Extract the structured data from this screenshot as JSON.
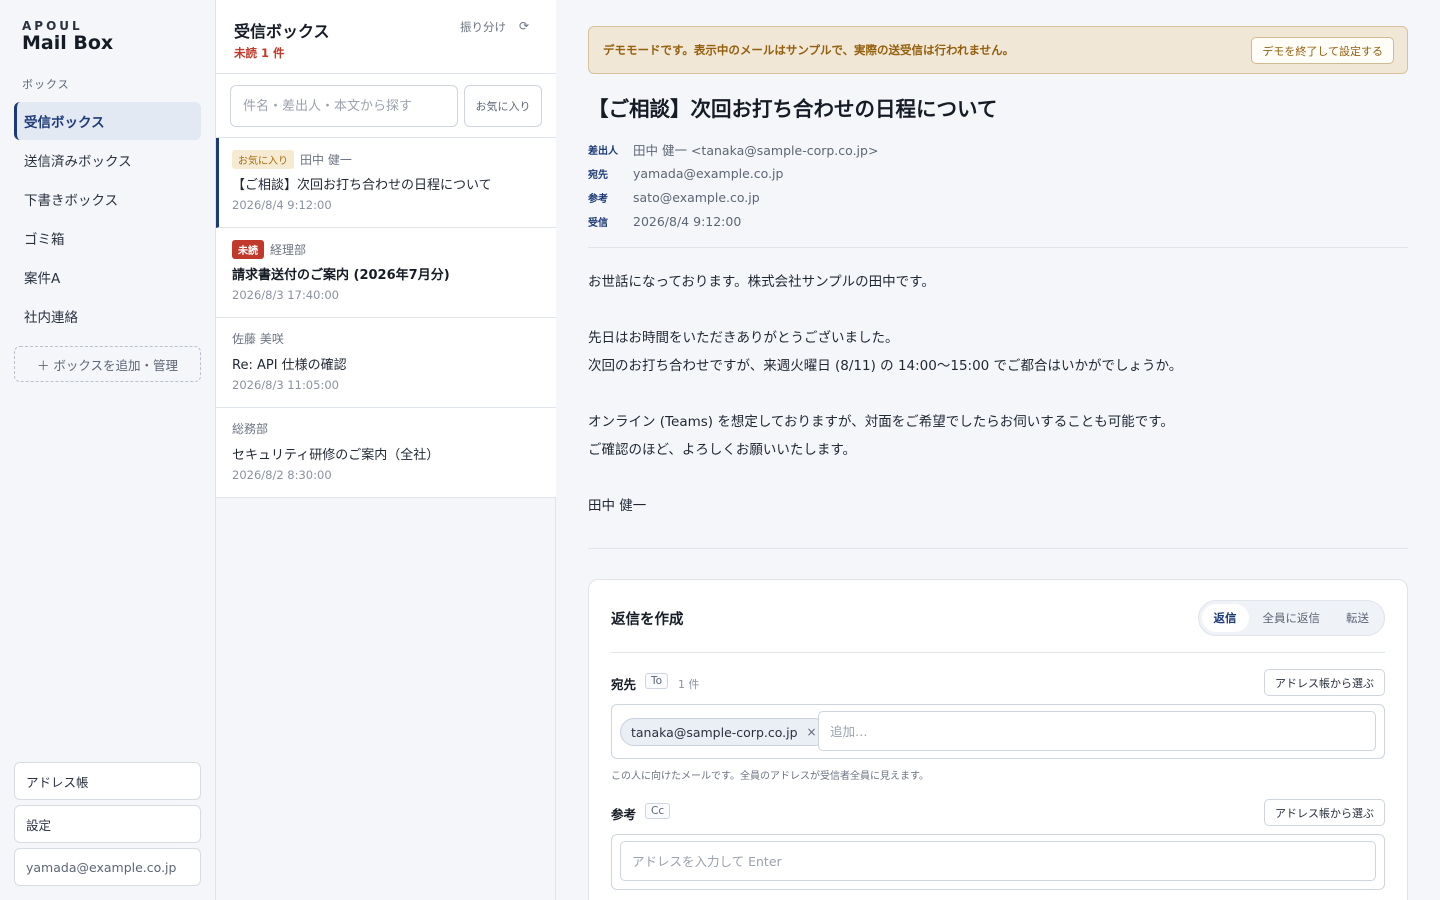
{
  "brand": {
    "small": "APOUL",
    "big": "Mail Box"
  },
  "sidebar": {
    "section_label": "ボックス",
    "items": [
      {
        "label": "受信ボックス"
      },
      {
        "label": "送信済みボックス"
      },
      {
        "label": "下書きボックス"
      },
      {
        "label": "ゴミ箱"
      },
      {
        "label": "案件A"
      },
      {
        "label": "社内連絡"
      }
    ],
    "add_box": "＋ ボックスを追加・管理",
    "address_book": "アドレス帳",
    "settings": "設定",
    "account": "yamada@example.co.jp"
  },
  "list": {
    "title": "受信ボックス",
    "unread": "未読 1 件",
    "sort": "振り分け",
    "refresh_icon": "⟳",
    "search_placeholder": "件名・差出人・本文から探す",
    "fav_filter": "お気に入り",
    "messages": [
      {
        "badge": "お気に入り",
        "from": "田中 健一",
        "subject": "【ご相談】次回お打ち合わせの日程について",
        "date": "2026/8/4 9:12:00"
      },
      {
        "badge": "未読",
        "from": "経理部",
        "subject": "請求書送付のご案内 (2026年7月分)",
        "date": "2026/8/3 17:40:00"
      },
      {
        "from": "佐藤 美咲",
        "subject": "Re: API 仕様の確認",
        "date": "2026/8/3 11:05:00"
      },
      {
        "from": "総務部",
        "subject": "セキュリティ研修のご案内（全社）",
        "date": "2026/8/2 8:30:00"
      }
    ]
  },
  "banner": {
    "text": "デモモードです。表示中のメールはサンプルで、実際の送受信は行われません。",
    "button": "デモを終了して設定する"
  },
  "mail": {
    "subject": "【ご相談】次回お打ち合わせの日程について",
    "meta": [
      {
        "label": "差出人",
        "value": "田中 健一 <tanaka@sample-corp.co.jp>"
      },
      {
        "label": "宛先",
        "value": "yamada@example.co.jp"
      },
      {
        "label": "参考",
        "value": "sato@example.co.jp"
      },
      {
        "label": "受信",
        "value": "2026/8/4 9:12:00"
      }
    ],
    "body": [
      "お世話になっております。株式会社サンプルの田中です。",
      "",
      "先日はお時間をいただきありがとうございました。",
      "次回のお打ち合わせですが、来週火曜日 (8/11) の 14:00〜15:00 でご都合はいかがでしょうか。",
      "",
      "オンライン (Teams) を想定しておりますが、対面をご希望でしたらお伺いすることも可能です。",
      "ご確認のほど、よろしくお願いいたします。",
      "",
      "田中 健一"
    ]
  },
  "compose": {
    "title": "返信を作成",
    "modes": [
      "返信",
      "全員に返信",
      "転送"
    ],
    "to": {
      "label": "宛先",
      "tag": "To",
      "count": "1 件",
      "address_book": "アドレス帳から選ぶ",
      "chip": "tanaka@sample-corp.co.jp",
      "chip_remove": "×",
      "placeholder": "追加…",
      "hint": "この人に向けたメールです。全員のアドレスが受信者全員に見えます。"
    },
    "cc": {
      "label": "参考",
      "tag": "Cc",
      "address_book": "アドレス帳から選ぶ",
      "placeholder": "アドレスを入力して Enter"
    }
  },
  "colors": {
    "accent": "#1d3a78",
    "unread_badge": "#c0392b",
    "banner_bg": "#f1e7d6",
    "banner_text": "#94600e"
  }
}
